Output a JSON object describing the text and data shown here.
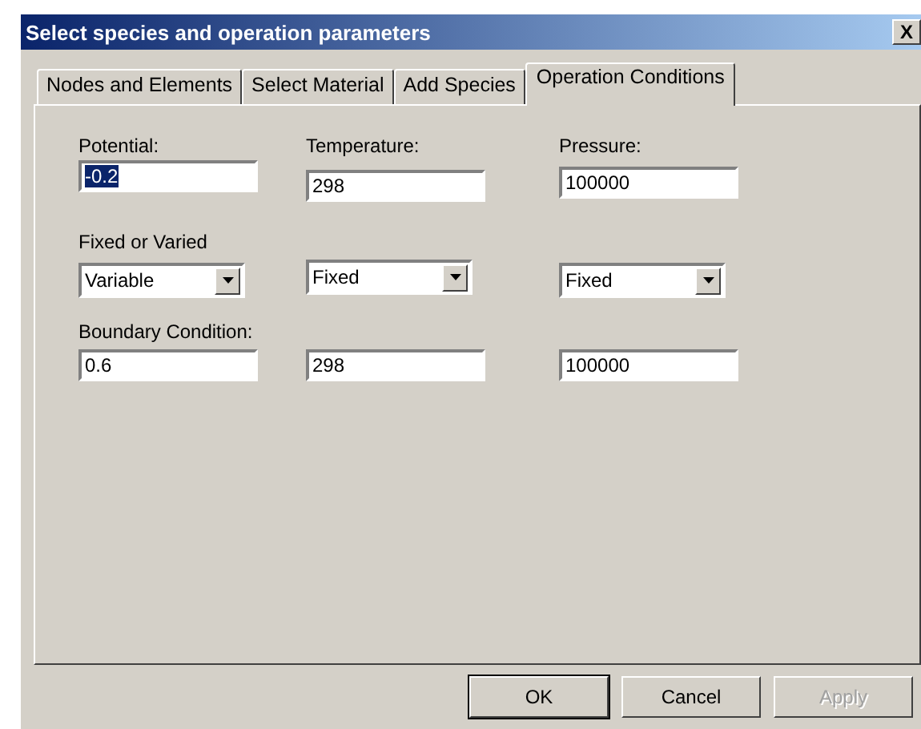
{
  "window": {
    "title": "Select species and operation parameters",
    "close": "X"
  },
  "tabs": [
    {
      "label": "Nodes and Elements",
      "selected": false
    },
    {
      "label": "Select Material",
      "selected": false
    },
    {
      "label": "Add Species",
      "selected": false
    },
    {
      "label": "Operation Conditions",
      "selected": true
    }
  ],
  "parameters": [
    {
      "label": "Potential:",
      "value": "-0.2",
      "text_selected": true
    },
    {
      "label": "Temperature:",
      "value": "298",
      "text_selected": false
    },
    {
      "label": "Pressure:",
      "value": "100000",
      "text_selected": false
    }
  ],
  "fixed_or_varied": {
    "label": "Fixed or Varied",
    "dropdowns": [
      "Variable",
      "Fixed",
      "Fixed"
    ]
  },
  "boundary_condition": {
    "label": "Boundary Condition:",
    "values": [
      "0.6",
      "298",
      "100000"
    ]
  },
  "buttons": [
    {
      "label": "OK",
      "default": true,
      "disabled": false
    },
    {
      "label": "Cancel",
      "default": false,
      "disabled": false
    },
    {
      "label": "Apply",
      "default": false,
      "disabled": true
    }
  ]
}
